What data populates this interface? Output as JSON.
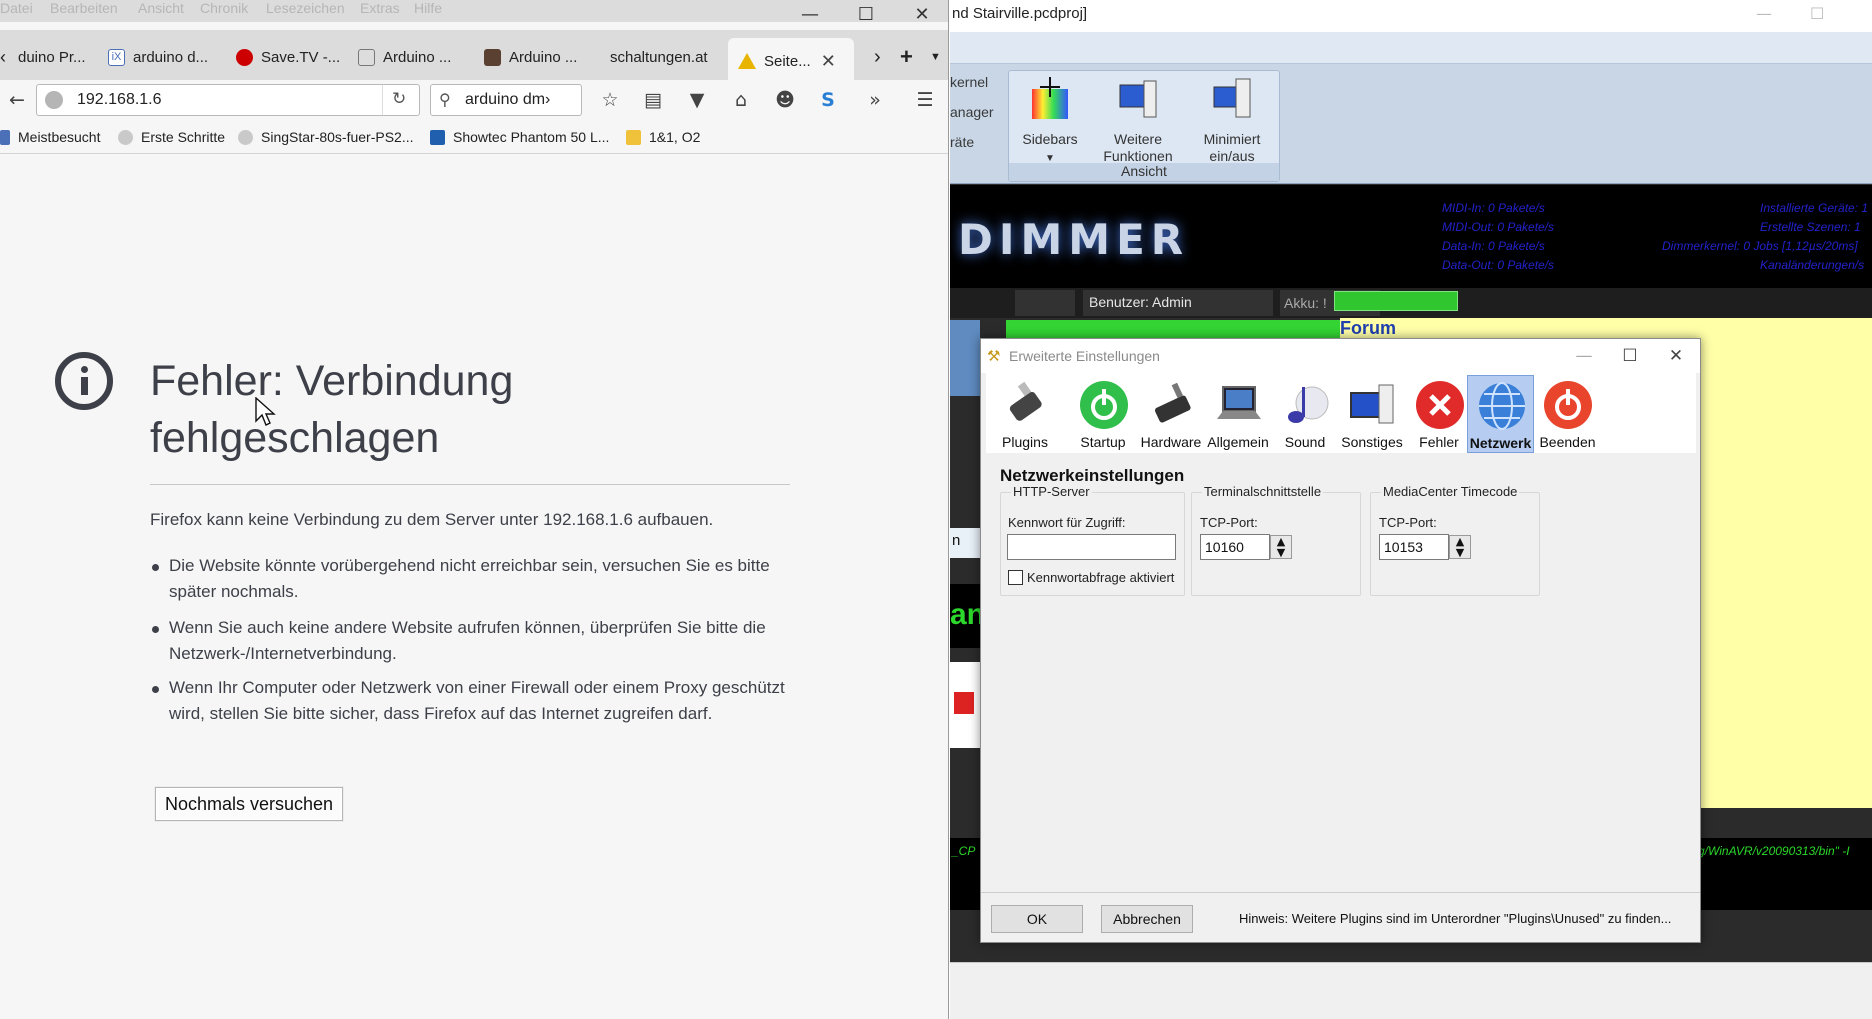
{
  "firefox": {
    "menu": [
      "Datei",
      "Bearbeiten",
      "Ansicht",
      "Chronik",
      "Lesezeichen",
      "Extras",
      "Hilfe"
    ],
    "tabs": [
      {
        "label": "duino Pr..."
      },
      {
        "label": "arduino d..."
      },
      {
        "label": "Save.TV -..."
      },
      {
        "label": "Arduino ..."
      },
      {
        "label": "Arduino ..."
      },
      {
        "label": "schaltungen.at"
      },
      {
        "label": "Seite..."
      }
    ],
    "url": "192.168.1.6",
    "search_value": "arduino dm›",
    "bookmarks": [
      "Meistbesucht",
      "Erste Schritte",
      "SingStar-80s-fuer-PS2...",
      "Showtec Phantom 50 L...",
      "1&1, O2"
    ],
    "error": {
      "title": "Fehler: Verbindung fehlgeschlagen",
      "description": "Firefox kann keine Verbindung zu dem Server unter 192.168.1.6 aufbauen.",
      "bullets": [
        "Die Website könnte vorübergehend nicht erreichbar sein, versuchen Sie es bitte später nochmals.",
        "Wenn Sie auch keine andere Website aufrufen können, überprüfen Sie bitte die Netzwerk-/Internetverbindung.",
        "Wenn Ihr Computer oder Netzwerk von einer Firewall oder einem Proxy geschützt wird, stellen Sie bitte sicher, dass Firefox auf das Internet zugreifen darf."
      ],
      "retry_label": "Nochmals versuchen"
    }
  },
  "dmx": {
    "window_title": "nd Stairville.pcdproj]",
    "ribbon_side": [
      "kernel",
      "anager",
      "räte"
    ],
    "ribbon": {
      "items": [
        {
          "label": "Sidebars"
        },
        {
          "label": "Weitere Funktionen"
        },
        {
          "label": "Minimiert ein/aus"
        }
      ],
      "group_label": "Ansicht"
    },
    "logo": "DIMMER",
    "stats_left": [
      "MIDI-In: 0 Pakete/s",
      "MIDI-Out: 0 Pakete/s",
      "Data-In: 0 Pakete/s",
      "Data-Out: 0 Pakete/s"
    ],
    "stats_right": [
      "Installierte Geräte: 1",
      "Erstellte Szenen: 1",
      "Dimmerkernel: 0 Jobs [1,12µs/20ms]",
      "Kanaländerungen/s"
    ],
    "user": "Benutzer: Admin",
    "akku": "Akku: !",
    "akku_level": 1.0,
    "forum": "Forum",
    "term_left": "_CP",
    "term_right": "g/WinAVR/v20090313/bin\" -I",
    "side_fragments": [
      "n",
      "an"
    ]
  },
  "dialog": {
    "title": "Erweiterte Einstellungen",
    "tools": [
      {
        "label": "Plugins",
        "icon": "plugins-icon",
        "color": "#444444"
      },
      {
        "label": "Startup",
        "icon": "startup-icon",
        "color": "#2fbf4a"
      },
      {
        "label": "Hardware",
        "icon": "hardware-icon",
        "color": "#333333"
      },
      {
        "label": "Allgemein",
        "icon": "laptop-icon",
        "color": "#555555"
      },
      {
        "label": "Sound",
        "icon": "music-note-icon",
        "color": "#3a3aa8"
      },
      {
        "label": "Sonstiges",
        "icon": "monitor-icon",
        "color": "#2450c8"
      },
      {
        "label": "Fehler",
        "icon": "error-icon",
        "color": "#e12b2b"
      },
      {
        "label": "Netzwerk",
        "icon": "globe-icon",
        "color": "#2d6fd2"
      },
      {
        "label": "Beenden",
        "icon": "power-icon",
        "color": "#e8452c"
      }
    ],
    "section_title": "Netzwerkeinstellungen",
    "http": {
      "title": "HTTP-Server",
      "password_label": "Kennwort für Zugriff:",
      "password_value": "",
      "checkbox_label": "Kennwortabfrage aktiviert",
      "checkbox_checked": false
    },
    "terminal": {
      "title": "Terminalschnittstelle",
      "port_label": "TCP-Port:",
      "port_value": "10160"
    },
    "mediacenter": {
      "title": "MediaCenter Timecode",
      "port_label": "TCP-Port:",
      "port_value": "10153"
    },
    "ok_label": "OK",
    "cancel_label": "Abbrechen",
    "hint": "Hinweis: Weitere Plugins sind im Unterordner \"Plugins\\Unused\" zu finden..."
  }
}
